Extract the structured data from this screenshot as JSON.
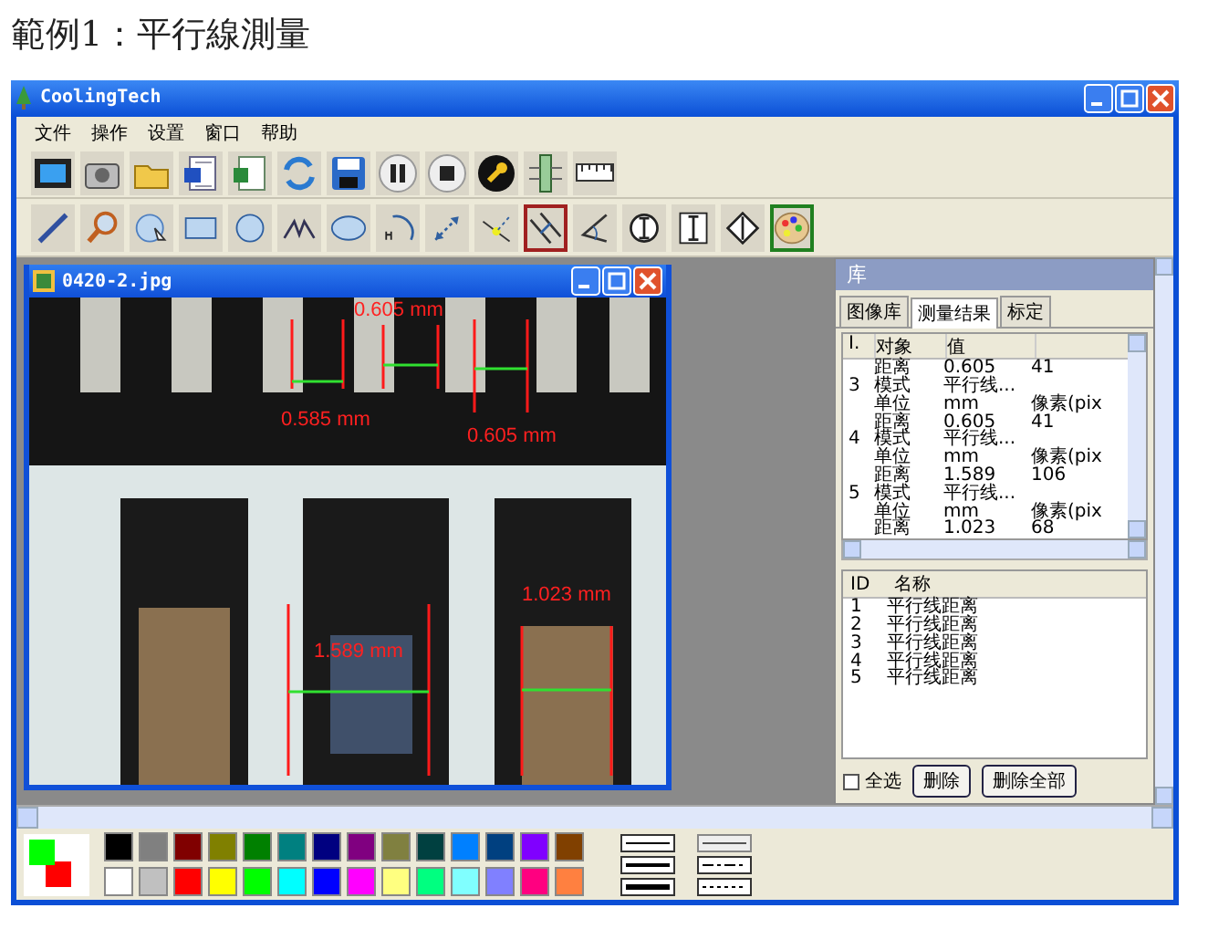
{
  "heading": "範例1：平行線測量",
  "window": {
    "title": "CoolingTech"
  },
  "menu": [
    "文件",
    "操作",
    "设置",
    "窗口",
    "帮助"
  ],
  "toolbar": [
    {
      "kind": "video"
    },
    {
      "kind": "camera"
    },
    {
      "kind": "folder"
    },
    {
      "kind": "word"
    },
    {
      "kind": "excel"
    },
    {
      "kind": "refresh"
    },
    {
      "kind": "save"
    },
    {
      "kind": "pause"
    },
    {
      "kind": "stop"
    },
    {
      "kind": "wrench"
    },
    {
      "kind": "ruler-v"
    },
    {
      "kind": "ruler-h"
    }
  ],
  "tools": [
    {
      "kind": "line",
      "selected": false
    },
    {
      "kind": "zoom",
      "selected": false
    },
    {
      "kind": "circle-pick",
      "selected": false
    },
    {
      "kind": "rectangle",
      "selected": false
    },
    {
      "kind": "circle",
      "selected": false
    },
    {
      "kind": "polyline",
      "selected": false
    },
    {
      "kind": "ellipse",
      "selected": false
    },
    {
      "kind": "arc",
      "selected": false
    },
    {
      "kind": "distance",
      "selected": false
    },
    {
      "kind": "point-line",
      "selected": false
    },
    {
      "kind": "parallel",
      "selected": true
    },
    {
      "kind": "angle",
      "selected": false
    },
    {
      "kind": "circle-i",
      "selected": false
    },
    {
      "kind": "box-i",
      "selected": false
    },
    {
      "kind": "diamond",
      "selected": false
    },
    {
      "kind": "palette",
      "selected": true
    }
  ],
  "image_window": {
    "title": "0420-2.jpg",
    "measurements": [
      {
        "label": "0.605 mm"
      },
      {
        "label": "0.585 mm"
      },
      {
        "label": "0.605 mm"
      },
      {
        "label": "1.023 mm"
      },
      {
        "label": "1.589 mm"
      }
    ]
  },
  "panel": {
    "title": "库",
    "tabs": [
      {
        "label": "图像库",
        "selected": false
      },
      {
        "label": "测量结果",
        "selected": true
      },
      {
        "label": "标定",
        "selected": false
      }
    ],
    "results": {
      "columns": [
        "I.",
        "对象",
        "值"
      ],
      "rows": [
        {
          "id": "",
          "object": "距离",
          "value": "0.605",
          "column_4": "41"
        },
        {
          "id": "3",
          "object": "模式",
          "value": "平行线...",
          "column_4": ""
        },
        {
          "id": "",
          "object": "单位",
          "value": "mm",
          "column_4": "像素(pix"
        },
        {
          "id": "",
          "object": "距离",
          "value": "0.605",
          "column_4": "41"
        },
        {
          "id": "4",
          "object": "模式",
          "value": "平行线...",
          "column_4": ""
        },
        {
          "id": "",
          "object": "单位",
          "value": "mm",
          "column_4": "像素(pix"
        },
        {
          "id": "",
          "object": "距离",
          "value": "1.589",
          "column_4": "106"
        },
        {
          "id": "5",
          "object": "模式",
          "value": "平行线...",
          "column_4": ""
        },
        {
          "id": "",
          "object": "单位",
          "value": "mm",
          "column_4": "像素(pix"
        },
        {
          "id": "",
          "object": "距离",
          "value": "1.023",
          "column_4": "68"
        }
      ]
    },
    "list": {
      "columns": [
        "ID",
        "名称"
      ],
      "rows": [
        {
          "id": "1",
          "name": "平行线距离"
        },
        {
          "id": "2",
          "name": "平行线距离"
        },
        {
          "id": "3",
          "name": "平行线距离"
        },
        {
          "id": "4",
          "name": "平行线距离"
        },
        {
          "id": "5",
          "name": "平行线距离"
        }
      ]
    },
    "select_all": {
      "label": "全选",
      "checked": false
    },
    "buttons": [
      "删除",
      "删除全部"
    ]
  },
  "palette": {
    "current_colors": [
      {
        "color": "#00ff00"
      },
      {
        "color": "#ff0000"
      }
    ],
    "colors": [
      {
        "color": "#000000"
      },
      {
        "color": "#808080"
      },
      {
        "color": "#800000"
      },
      {
        "color": "#808000"
      },
      {
        "color": "#008000"
      },
      {
        "color": "#008080"
      },
      {
        "color": "#000080"
      },
      {
        "color": "#800080"
      },
      {
        "color": "#808040"
      },
      {
        "color": "#004040"
      },
      {
        "color": "#0080ff"
      },
      {
        "color": "#004080"
      },
      {
        "color": "#8000ff"
      },
      {
        "color": "#804000"
      },
      {
        "color": "#ffffff"
      },
      {
        "color": "#c0c0c0"
      },
      {
        "color": "#ff0000"
      },
      {
        "color": "#ffff00"
      },
      {
        "color": "#00ff00"
      },
      {
        "color": "#00ffff"
      },
      {
        "color": "#0000ff"
      },
      {
        "color": "#ff00ff"
      },
      {
        "color": "#ffff80"
      },
      {
        "color": "#00ff80"
      },
      {
        "color": "#80ffff"
      },
      {
        "color": "#8080ff"
      },
      {
        "color": "#ff0080"
      },
      {
        "color": "#ff8040"
      }
    ]
  }
}
